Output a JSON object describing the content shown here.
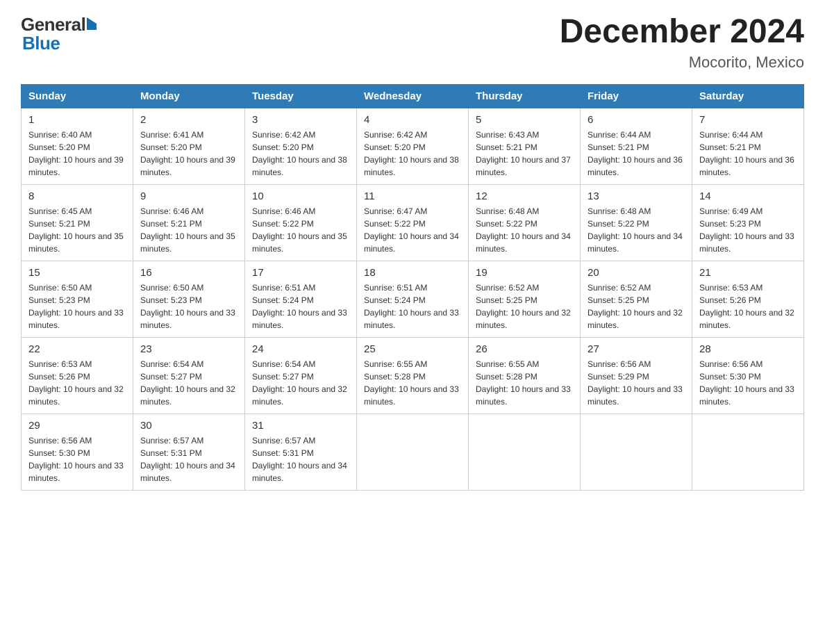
{
  "header": {
    "logo_general": "General",
    "logo_blue": "Blue",
    "main_title": "December 2024",
    "subtitle": "Mocorito, Mexico"
  },
  "calendar": {
    "days_of_week": [
      "Sunday",
      "Monday",
      "Tuesday",
      "Wednesday",
      "Thursday",
      "Friday",
      "Saturday"
    ],
    "weeks": [
      [
        {
          "day": "1",
          "sunrise": "6:40 AM",
          "sunset": "5:20 PM",
          "daylight": "10 hours and 39 minutes."
        },
        {
          "day": "2",
          "sunrise": "6:41 AM",
          "sunset": "5:20 PM",
          "daylight": "10 hours and 39 minutes."
        },
        {
          "day": "3",
          "sunrise": "6:42 AM",
          "sunset": "5:20 PM",
          "daylight": "10 hours and 38 minutes."
        },
        {
          "day": "4",
          "sunrise": "6:42 AM",
          "sunset": "5:20 PM",
          "daylight": "10 hours and 38 minutes."
        },
        {
          "day": "5",
          "sunrise": "6:43 AM",
          "sunset": "5:21 PM",
          "daylight": "10 hours and 37 minutes."
        },
        {
          "day": "6",
          "sunrise": "6:44 AM",
          "sunset": "5:21 PM",
          "daylight": "10 hours and 36 minutes."
        },
        {
          "day": "7",
          "sunrise": "6:44 AM",
          "sunset": "5:21 PM",
          "daylight": "10 hours and 36 minutes."
        }
      ],
      [
        {
          "day": "8",
          "sunrise": "6:45 AM",
          "sunset": "5:21 PM",
          "daylight": "10 hours and 35 minutes."
        },
        {
          "day": "9",
          "sunrise": "6:46 AM",
          "sunset": "5:21 PM",
          "daylight": "10 hours and 35 minutes."
        },
        {
          "day": "10",
          "sunrise": "6:46 AM",
          "sunset": "5:22 PM",
          "daylight": "10 hours and 35 minutes."
        },
        {
          "day": "11",
          "sunrise": "6:47 AM",
          "sunset": "5:22 PM",
          "daylight": "10 hours and 34 minutes."
        },
        {
          "day": "12",
          "sunrise": "6:48 AM",
          "sunset": "5:22 PM",
          "daylight": "10 hours and 34 minutes."
        },
        {
          "day": "13",
          "sunrise": "6:48 AM",
          "sunset": "5:22 PM",
          "daylight": "10 hours and 34 minutes."
        },
        {
          "day": "14",
          "sunrise": "6:49 AM",
          "sunset": "5:23 PM",
          "daylight": "10 hours and 33 minutes."
        }
      ],
      [
        {
          "day": "15",
          "sunrise": "6:50 AM",
          "sunset": "5:23 PM",
          "daylight": "10 hours and 33 minutes."
        },
        {
          "day": "16",
          "sunrise": "6:50 AM",
          "sunset": "5:23 PM",
          "daylight": "10 hours and 33 minutes."
        },
        {
          "day": "17",
          "sunrise": "6:51 AM",
          "sunset": "5:24 PM",
          "daylight": "10 hours and 33 minutes."
        },
        {
          "day": "18",
          "sunrise": "6:51 AM",
          "sunset": "5:24 PM",
          "daylight": "10 hours and 33 minutes."
        },
        {
          "day": "19",
          "sunrise": "6:52 AM",
          "sunset": "5:25 PM",
          "daylight": "10 hours and 32 minutes."
        },
        {
          "day": "20",
          "sunrise": "6:52 AM",
          "sunset": "5:25 PM",
          "daylight": "10 hours and 32 minutes."
        },
        {
          "day": "21",
          "sunrise": "6:53 AM",
          "sunset": "5:26 PM",
          "daylight": "10 hours and 32 minutes."
        }
      ],
      [
        {
          "day": "22",
          "sunrise": "6:53 AM",
          "sunset": "5:26 PM",
          "daylight": "10 hours and 32 minutes."
        },
        {
          "day": "23",
          "sunrise": "6:54 AM",
          "sunset": "5:27 PM",
          "daylight": "10 hours and 32 minutes."
        },
        {
          "day": "24",
          "sunrise": "6:54 AM",
          "sunset": "5:27 PM",
          "daylight": "10 hours and 32 minutes."
        },
        {
          "day": "25",
          "sunrise": "6:55 AM",
          "sunset": "5:28 PM",
          "daylight": "10 hours and 33 minutes."
        },
        {
          "day": "26",
          "sunrise": "6:55 AM",
          "sunset": "5:28 PM",
          "daylight": "10 hours and 33 minutes."
        },
        {
          "day": "27",
          "sunrise": "6:56 AM",
          "sunset": "5:29 PM",
          "daylight": "10 hours and 33 minutes."
        },
        {
          "day": "28",
          "sunrise": "6:56 AM",
          "sunset": "5:30 PM",
          "daylight": "10 hours and 33 minutes."
        }
      ],
      [
        {
          "day": "29",
          "sunrise": "6:56 AM",
          "sunset": "5:30 PM",
          "daylight": "10 hours and 33 minutes."
        },
        {
          "day": "30",
          "sunrise": "6:57 AM",
          "sunset": "5:31 PM",
          "daylight": "10 hours and 34 minutes."
        },
        {
          "day": "31",
          "sunrise": "6:57 AM",
          "sunset": "5:31 PM",
          "daylight": "10 hours and 34 minutes."
        },
        null,
        null,
        null,
        null
      ]
    ]
  }
}
